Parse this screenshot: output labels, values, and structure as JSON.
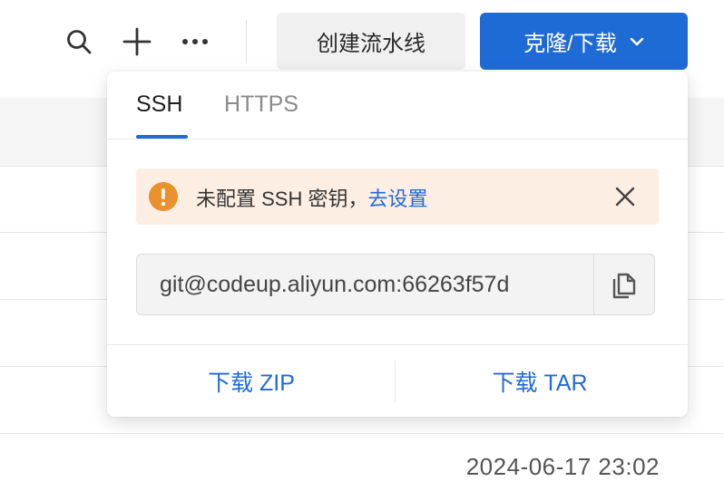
{
  "toolbar": {
    "create_pipeline_label": "创建流水线",
    "clone_download_label": "克隆/下载"
  },
  "popover": {
    "tabs": [
      {
        "label": "SSH",
        "active": true
      },
      {
        "label": "HTTPS",
        "active": false
      }
    ],
    "alert": {
      "message": "未配置 SSH 密钥，",
      "link": "去设置"
    },
    "url_value": "git@codeup.aliyun.com:66263f57d",
    "download_zip": "下载 ZIP",
    "download_tar": "下载 TAR"
  },
  "table": {
    "last_row_time": "2024-06-17 23:02"
  },
  "icons": [
    "search-icon",
    "plus-icon",
    "more-icon",
    "chevron-down-icon",
    "warning-icon",
    "close-icon",
    "copy-icon"
  ],
  "colors": {
    "accent": "#1f6bd6",
    "warning": "#e8912d",
    "alert_bg": "#fdeee3"
  }
}
